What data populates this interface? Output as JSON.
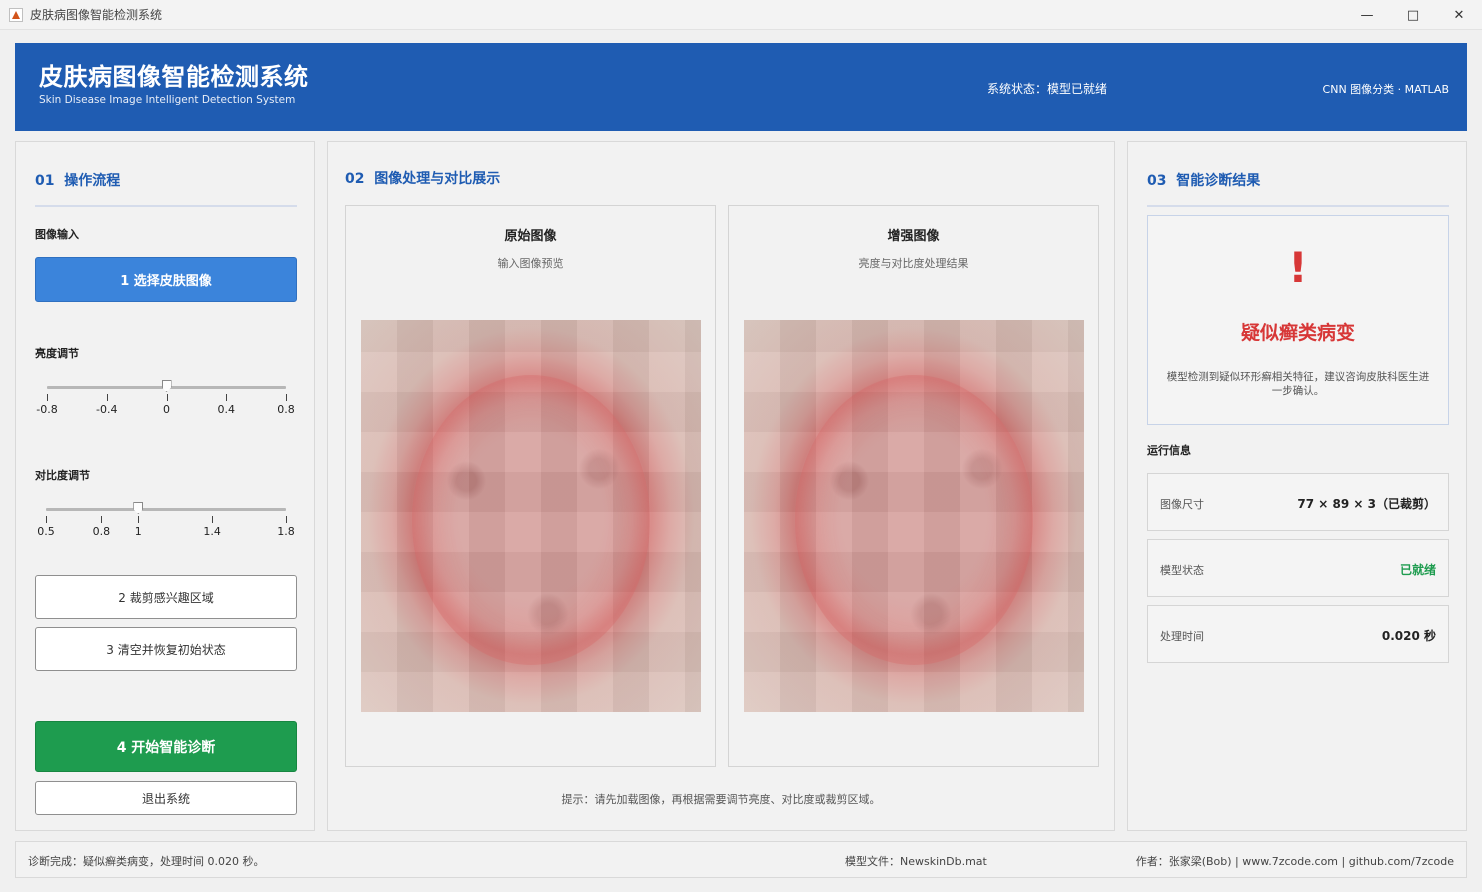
{
  "window": {
    "title": "皮肤病图像智能检测系统",
    "minimize_icon": "minimize-icon",
    "maximize_icon": "maximize-icon",
    "close_icon": "close-icon"
  },
  "header": {
    "title": "皮肤病图像智能检测系统",
    "subtitle": "Skin Disease Image Intelligent Detection System",
    "status": "系统状态：模型已就绪",
    "tech": "CNN 图像分类 · MATLAB",
    "background_color": "#1f5cb2"
  },
  "left_panel": {
    "number": "01",
    "title": "操作流程",
    "image_input_label": "图像输入",
    "select_button": "1  选择皮肤图像",
    "brightness": {
      "label": "亮度调节",
      "ticks": [
        "-0.8",
        "-0.4",
        "0",
        "0.4",
        "0.8"
      ],
      "value": 0
    },
    "contrast": {
      "label": "对比度调节",
      "ticks": [
        "0.5",
        "0.8",
        "1",
        "1.4",
        "1.8"
      ],
      "value": 1
    },
    "crop_button": "2  裁剪感兴趣区域",
    "reset_button": "3  清空并恢复初始状态",
    "diagnose_button": "4  开始智能诊断",
    "exit_button": "退出系统"
  },
  "middle_panel": {
    "number": "02",
    "title": "图像处理与对比展示",
    "original": {
      "title": "原始图像",
      "subtitle": "输入图像预览"
    },
    "enhanced": {
      "title": "增强图像",
      "subtitle": "亮度与对比度处理结果"
    },
    "tip": "提示：请先加载图像，再根据需要调节亮度、对比度或裁剪区域。"
  },
  "right_panel": {
    "number": "03",
    "title": "智能诊断结果",
    "alert_icon": "!",
    "result": "疑似癣类病变",
    "description": "模型检测到疑似环形癣相关特征，建议咨询皮肤科医生进一步确认。",
    "run_info_label": "运行信息",
    "info": [
      {
        "label": "图像尺寸",
        "value": "77 × 89 × 3（已裁剪）"
      },
      {
        "label": "模型状态",
        "value": "已就绪"
      },
      {
        "label": "处理时间",
        "value": "0.020 秒"
      }
    ],
    "alert_color": "#d73737",
    "ok_color": "#1e9c4f"
  },
  "statusbar": {
    "left": "诊断完成：疑似癣类病变，处理时间 0.020 秒。",
    "middle": "模型文件：NewskinDb.mat",
    "right": "作者：张家梁(Bob) | www.7zcode.com | github.com/7zcode"
  }
}
